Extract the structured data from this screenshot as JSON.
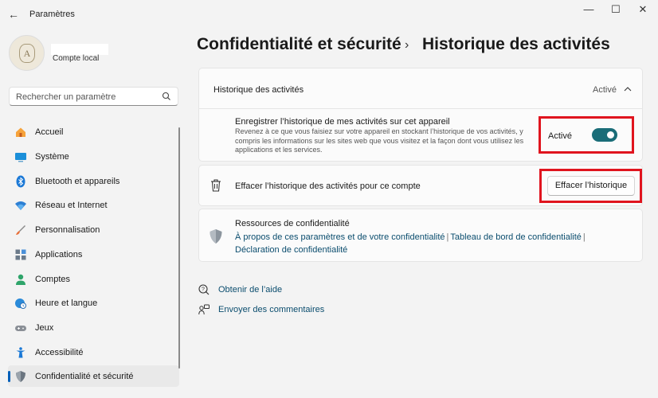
{
  "window": {
    "app_title": "Paramètres",
    "back": "←",
    "minimize": "—",
    "maximize": "☐",
    "close": "✕"
  },
  "profile": {
    "avatar_letter": "A",
    "account_type": "Compte local"
  },
  "search": {
    "placeholder": "Rechercher un paramètre"
  },
  "sidebar": {
    "items": [
      {
        "label": "Accueil",
        "icon": "home-icon",
        "active": false
      },
      {
        "label": "Système",
        "icon": "monitor-icon",
        "active": false
      },
      {
        "label": "Bluetooth et appareils",
        "icon": "bluetooth-icon",
        "active": false
      },
      {
        "label": "Réseau et Internet",
        "icon": "wifi-icon",
        "active": false
      },
      {
        "label": "Personnalisation",
        "icon": "brush-icon",
        "active": false
      },
      {
        "label": "Applications",
        "icon": "apps-icon",
        "active": false
      },
      {
        "label": "Comptes",
        "icon": "person-icon",
        "active": false
      },
      {
        "label": "Heure et langue",
        "icon": "globe-clock-icon",
        "active": false
      },
      {
        "label": "Jeux",
        "icon": "gamepad-icon",
        "active": false
      },
      {
        "label": "Accessibilité",
        "icon": "accessibility-icon",
        "active": false
      },
      {
        "label": "Confidentialité et sécurité",
        "icon": "shield-icon",
        "active": true
      }
    ]
  },
  "breadcrumb": {
    "parent": "Confidentialité et sécurité",
    "separator": "›",
    "current": "Historique des activités"
  },
  "activity_section": {
    "title": "Historique des activités",
    "state": "Activé",
    "store_setting": {
      "title": "Enregistrer l’historique de mes activités sur cet appareil",
      "description": "Revenez à ce que vous faisiez sur votre appareil en stockant l’historique de vos activités, y compris les informations sur les sites web que vous visitez et la façon dont vous utilisez les applications et les services.",
      "toggle_label": "Activé",
      "toggle_on": true
    }
  },
  "clear_section": {
    "label": "Effacer l’historique des activités pour ce compte",
    "button": "Effacer l’historique"
  },
  "resources": {
    "title": "Ressources de confidentialité",
    "link1": "À propos de ces paramètres et de votre confidentialité",
    "link2": "Tableau de bord de confidentialité",
    "link3": "Déclaration de confidentialité",
    "separator": "|"
  },
  "footer": {
    "help": "Obtenir de l’aide",
    "feedback": "Envoyer des commentaires"
  },
  "colors": {
    "accent": "#005fb8",
    "toggle_on": "#1a6d78",
    "highlight": "#e0141e",
    "link": "#0b4d6e"
  }
}
